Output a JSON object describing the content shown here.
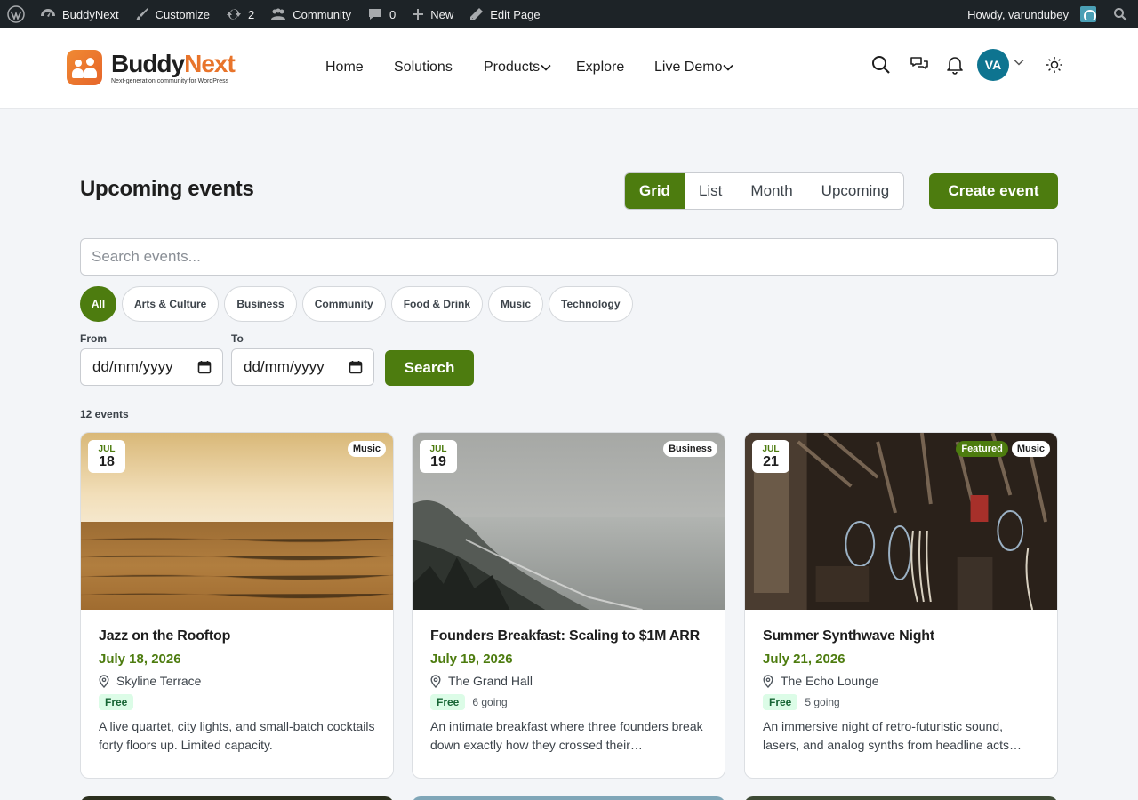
{
  "admin_bar": {
    "site_name": "BuddyNext",
    "customize": "Customize",
    "updates": "2",
    "community": "Community",
    "comments": "0",
    "new": "New",
    "edit_page": "Edit Page",
    "howdy": "Howdy, varundubey"
  },
  "header": {
    "logo_word_1": "Buddy",
    "logo_word_2": "Next",
    "logo_tagline": "Next-generation community for WordPress",
    "nav": [
      "Home",
      "Solutions",
      "Products",
      "Explore",
      "Live Demo"
    ],
    "avatar_initials": "VA"
  },
  "page": {
    "title": "Upcoming events",
    "views": [
      "Grid",
      "List",
      "Month",
      "Upcoming"
    ],
    "active_view": "Grid",
    "create_label": "Create event",
    "search_placeholder": "Search events...",
    "categories": [
      "All",
      "Arts & Culture",
      "Business",
      "Community",
      "Food & Drink",
      "Music",
      "Technology"
    ],
    "from_label": "From",
    "to_label": "To",
    "date_placeholder": "dd/mm/yyyy",
    "search_button": "Search",
    "count": "12 events"
  },
  "events": [
    {
      "month": "JUL",
      "day": "18",
      "tags": [
        "Music"
      ],
      "title": "Jazz on the Rooftop",
      "date": "July 18, 2026",
      "venue": "Skyline Terrace",
      "price": "Free",
      "going": "",
      "description": "A live quartet, city lights, and small-batch cocktails forty floors up. Limited capacity."
    },
    {
      "month": "JUL",
      "day": "19",
      "tags": [
        "Business"
      ],
      "title": "Founders Breakfast: Scaling to $1M ARR",
      "date": "July 19, 2026",
      "venue": "The Grand Hall",
      "price": "Free",
      "going": "6 going",
      "description": "An intimate breakfast where three founders break down exactly how they crossed their…"
    },
    {
      "month": "JUL",
      "day": "21",
      "tags": [
        "Featured",
        "Music"
      ],
      "title": "Summer Synthwave Night",
      "date": "July 21, 2026",
      "venue": "The Echo Lounge",
      "price": "Free",
      "going": "5 going",
      "description": "An immersive night of retro-futuristic sound, lasers, and analog synths from headline acts…"
    }
  ],
  "colors": {
    "accent": "#4d7c0f",
    "admin_bar": "#1d2327",
    "avatar": "#0e7490",
    "logo_orange": "#e8742b"
  }
}
